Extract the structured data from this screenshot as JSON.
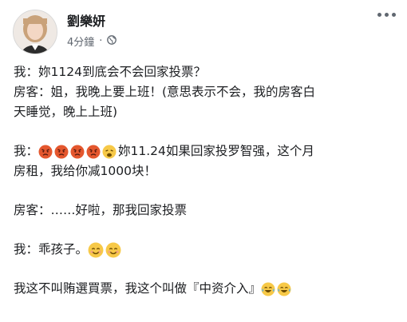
{
  "post": {
    "author": "劉樂妍",
    "time": "4分鐘",
    "lines": [
      "我：妳1124到底会不会回家投票？",
      "房客：姐，我晚上要上班！(意思表示不会，我的房客白",
      "天睡觉，晚上上班)",
      "我：",
      "妳11.24如果回家投罗智强，这个月",
      "房租，我给你减1000块！",
      "房客：……好啦，那我回家投票",
      "我：乖孩子。",
      "我这不叫贿選買票，我这个叫做『中资介入』"
    ]
  },
  "icons": {
    "privacy": "globe-icon",
    "menu": "more-icon",
    "angry": "angry-face-emoji",
    "weary": "weary-face-emoji",
    "smile": "smiling-face-emoji",
    "laugh": "tears-of-joy-emoji"
  },
  "colors": {
    "text": "#1c1e21",
    "meta": "#606770",
    "angry": "#e4572e",
    "emoji_yellow": "#f7c948"
  }
}
